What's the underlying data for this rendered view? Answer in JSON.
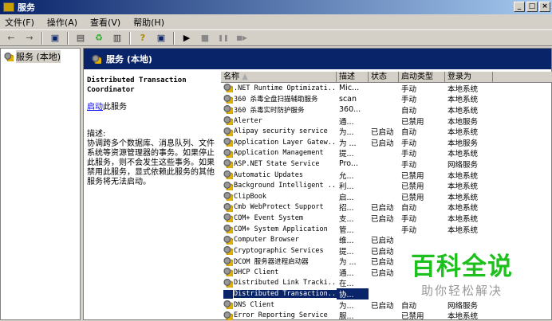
{
  "window": {
    "title": "服务"
  },
  "menu": [
    "文件(F)",
    "操作(A)",
    "查看(V)",
    "帮助(H)"
  ],
  "toolbar": {
    "icons": [
      "back-icon",
      "forward-icon",
      "show-hide-tree-icon",
      "properties-icon",
      "refresh-icon",
      "export-list-icon",
      "help-icon",
      "console-icon",
      "start-icon",
      "stop-icon",
      "pause-icon",
      "restart-icon"
    ],
    "glyphs": [
      "←",
      "→",
      "▣",
      "▤",
      "♻",
      "▥",
      "?",
      "▣",
      "▶",
      "■",
      "❚❚",
      "■▶"
    ]
  },
  "tree": {
    "root": "服务 (本地)"
  },
  "pane": {
    "title": "服务 (本地)"
  },
  "detail": {
    "service_name": "Distributed Transaction Coordinator",
    "start_link": "启动",
    "start_suffix": "此服务",
    "desc_label": "描述:",
    "desc_text": "协调跨多个数据库、消息队列、文件系统等资源管理器的事务。如果停止此服务，则不会发生这些事务。如果禁用此服务，显式依赖此服务的其他服务将无法启动。"
  },
  "columns": [
    "名称",
    "描述",
    "状态",
    "启动类型",
    "登录为"
  ],
  "rows": [
    {
      "name": ".NET Runtime Optimizati...",
      "desc": "Mic...",
      "status": "",
      "startup": "手动",
      "logon": "本地系统"
    },
    {
      "name": "360 杀毒全盘扫描辅助服务",
      "desc": "scan",
      "status": "",
      "startup": "手动",
      "logon": "本地系统"
    },
    {
      "name": "360 杀毒实时防护服务",
      "desc": "360...",
      "status": "",
      "startup": "自动",
      "logon": "本地系统"
    },
    {
      "name": "Alerter",
      "desc": "通...",
      "status": "",
      "startup": "已禁用",
      "logon": "本地服务"
    },
    {
      "name": "Alipay security service",
      "desc": "为...",
      "status": "已启动",
      "startup": "自动",
      "logon": "本地系统"
    },
    {
      "name": "Application Layer Gatew...",
      "desc": "为 ...",
      "status": "已启动",
      "startup": "手动",
      "logon": "本地服务"
    },
    {
      "name": "Application Management",
      "desc": "提...",
      "status": "",
      "startup": "手动",
      "logon": "本地系统"
    },
    {
      "name": "ASP.NET State Service",
      "desc": "Pro...",
      "status": "",
      "startup": "手动",
      "logon": "网络服务"
    },
    {
      "name": "Automatic Updates",
      "desc": "允...",
      "status": "",
      "startup": "已禁用",
      "logon": "本地系统"
    },
    {
      "name": "Background Intelligent ...",
      "desc": "利...",
      "status": "",
      "startup": "已禁用",
      "logon": "本地系统"
    },
    {
      "name": "ClipBook",
      "desc": "启...",
      "status": "",
      "startup": "已禁用",
      "logon": "本地系统"
    },
    {
      "name": "Cmb WebProtect Support",
      "desc": "招...",
      "status": "已启动",
      "startup": "自动",
      "logon": "本地系统"
    },
    {
      "name": "COM+ Event System",
      "desc": "支...",
      "status": "已启动",
      "startup": "手动",
      "logon": "本地系统"
    },
    {
      "name": "COM+ System Application",
      "desc": "管...",
      "status": "",
      "startup": "手动",
      "logon": "本地系统"
    },
    {
      "name": "Computer Browser",
      "desc": "维...",
      "status": "已启动",
      "startup": "",
      "logon": ""
    },
    {
      "name": "Cryptographic Services",
      "desc": "提...",
      "status": "已启动",
      "startup": "",
      "logon": ""
    },
    {
      "name": "DCOM 服务器进程启动器",
      "desc": "为 ...",
      "status": "已启动",
      "startup": "",
      "logon": ""
    },
    {
      "name": "DHCP Client",
      "desc": "通...",
      "status": "已启动",
      "startup": "",
      "logon": ""
    },
    {
      "name": "Distributed Link Tracki...",
      "desc": "在...",
      "status": "",
      "startup": "",
      "logon": ""
    },
    {
      "name": "Distributed Transaction...",
      "desc": "协...",
      "status": "",
      "startup": "",
      "logon": "",
      "selected": true
    },
    {
      "name": "DNS Client",
      "desc": "为...",
      "status": "已启动",
      "startup": "自动",
      "logon": "网络服务"
    },
    {
      "name": "Error Reporting Service",
      "desc": "服...",
      "status": "",
      "startup": "已禁用",
      "logon": "本地系统"
    }
  ],
  "watermark": {
    "main": "百科全说",
    "sub": "助你轻松解决"
  }
}
